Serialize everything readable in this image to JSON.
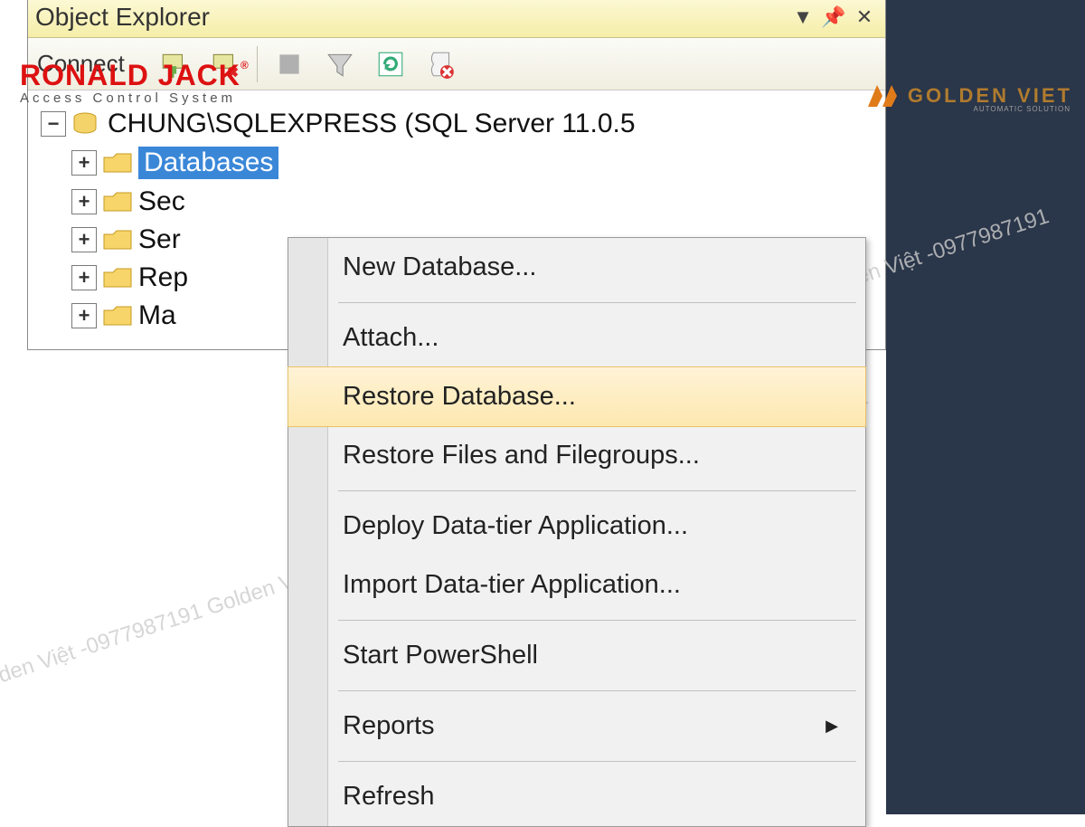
{
  "panel": {
    "title": "Object Explorer",
    "connect_label": "Connect"
  },
  "tree": {
    "server_label": "CHUNG\\SQLEXPRESS (SQL Server 11.0.5",
    "nodes": [
      {
        "label": "Databases",
        "selected": true
      },
      {
        "label": "Sec"
      },
      {
        "label": "Ser"
      },
      {
        "label": "Rep"
      },
      {
        "label": "Ma"
      }
    ]
  },
  "context_menu": {
    "items": [
      {
        "label": "New Database..."
      },
      {
        "sep": true
      },
      {
        "label": "Attach..."
      },
      {
        "label": "Restore Database...",
        "highlight": true
      },
      {
        "label": "Restore Files and Filegroups..."
      },
      {
        "sep": true
      },
      {
        "label": "Deploy Data-tier Application..."
      },
      {
        "label": "Import Data-tier Application..."
      },
      {
        "sep": true
      },
      {
        "label": "Start PowerShell"
      },
      {
        "sep": true
      },
      {
        "label": "Reports",
        "arrow": true
      },
      {
        "sep": true
      },
      {
        "label": "Refresh"
      }
    ]
  },
  "overlay": {
    "logo_left_line1": "RONALD JACK",
    "logo_left_line2": "Access Control System",
    "logo_right_text": "GOLDEN VIET",
    "logo_right_sub": "AUTOMATIC SOLUTION",
    "watermark": "Golden Việt -0977987191 Golden Việt -0977987191"
  }
}
